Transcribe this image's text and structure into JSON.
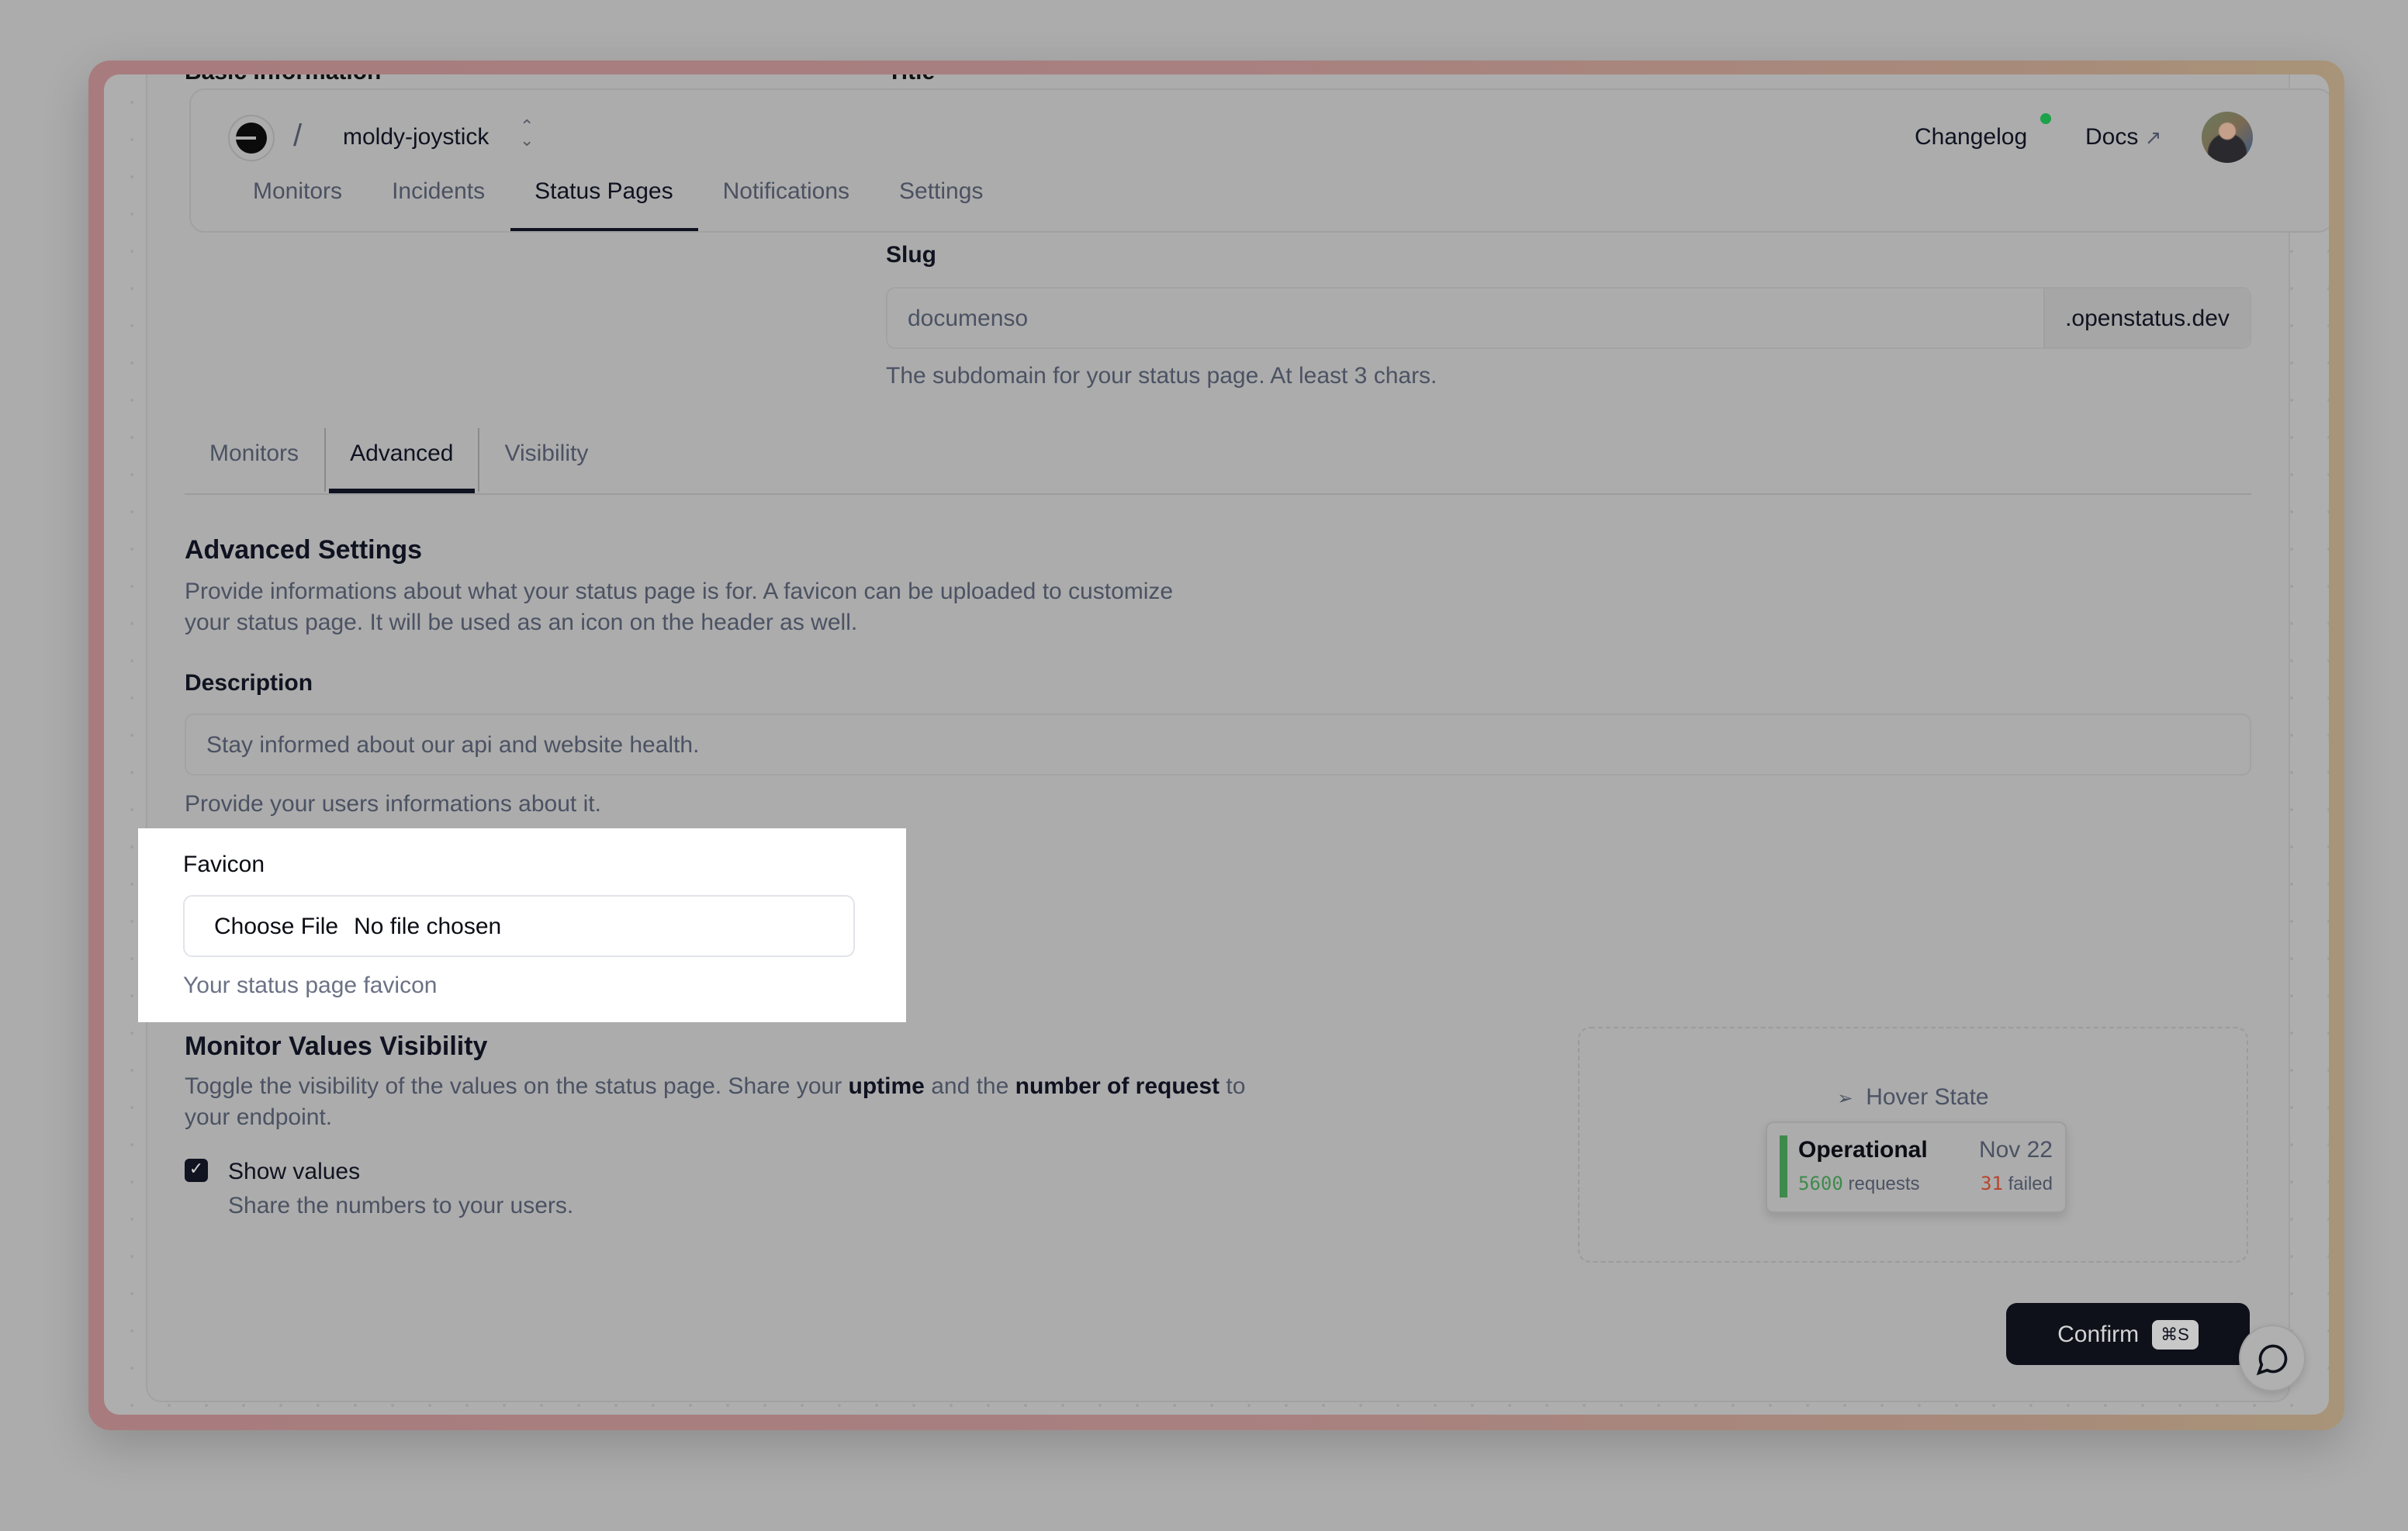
{
  "background_cut": {
    "basic_information": "Basic Information",
    "title_label": "Title"
  },
  "header": {
    "project_name": "moldy-joystick",
    "separator": "/",
    "nav": [
      {
        "label": "Monitors",
        "active": false
      },
      {
        "label": "Incidents",
        "active": false
      },
      {
        "label": "Status Pages",
        "active": true
      },
      {
        "label": "Notifications",
        "active": false
      },
      {
        "label": "Settings",
        "active": false
      }
    ],
    "changelog": "Changelog",
    "docs": "Docs",
    "docs_icon": "↗",
    "changelog_dot_color": "#1ba24a"
  },
  "slug": {
    "label": "Slug",
    "value": "documenso",
    "suffix": ".openstatus.dev",
    "help": "The subdomain for your status page. At least 3 chars."
  },
  "tabs": [
    {
      "label": "Monitors",
      "active": false
    },
    {
      "label": "Advanced",
      "active": true
    },
    {
      "label": "Visibility",
      "active": false
    }
  ],
  "advanced": {
    "title": "Advanced Settings",
    "description_line1": "Provide informations about what your status page is for. A favicon can be uploaded to customize",
    "description_line2": "your status page. It will be used as an icon on the header as well.",
    "description_label": "Description",
    "description_value": "Stay informed about our api and website health.",
    "description_help": "Provide your users informations about it.",
    "favicon_label": "Favicon",
    "file_button": "Choose File",
    "file_status": "No file chosen",
    "favicon_help": "Your status page favicon"
  },
  "visibility": {
    "title": "Monitor Values Visibility",
    "desc_part1": "Toggle the visibility of the values on the status page. Share your ",
    "desc_bold1": "uptime",
    "desc_part2": " and the ",
    "desc_bold2": "number of request",
    "desc_part3": " to",
    "desc_line2": "your endpoint.",
    "checkbox_label": "Show values",
    "checkbox_checked": true,
    "checkbox_help": "Share the numbers to your users."
  },
  "preview": {
    "hover_label": "Hover State",
    "status": "Operational",
    "date": "Nov 22",
    "requests_count": "5600",
    "requests_label": "requests",
    "failed_count": "31",
    "failed_label": "failed",
    "status_color": "#3e8a4c",
    "failed_color": "#b8442a"
  },
  "actions": {
    "confirm": "Confirm",
    "shortcut": "⌘S"
  }
}
